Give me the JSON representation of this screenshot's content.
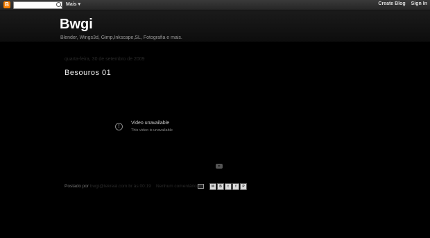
{
  "navbar": {
    "more_label": "Mais ▾",
    "create_blog": "Create Blog",
    "sign_in": "Sign In",
    "search_value": ""
  },
  "blog": {
    "title": "Bwgi",
    "description": "Blender, Wings3d, Gimp,Inkscape,SL, Fotografia e mais."
  },
  "post": {
    "date": "quarta-feira, 30 de setembro de 2009",
    "title": "Besouros 01",
    "video": {
      "title": "Video unavailable",
      "subtitle": "This video is unavailable"
    },
    "footer": {
      "posted_by": "Postado por",
      "author": "bwgi@tekreal.com.br",
      "at": "às",
      "time": "00:19",
      "comments": "Nenhum comentário:"
    },
    "share_buttons": [
      "M",
      "B",
      "t",
      "f",
      "P"
    ]
  },
  "icons": {
    "blogger": "blogger-logo-icon",
    "search": "search-icon",
    "alert": "alert-circle-icon",
    "youtube": "youtube-icon",
    "email": "email-post-icon"
  },
  "colors": {
    "blogger_orange": "#f57d00",
    "background": "#000000"
  }
}
